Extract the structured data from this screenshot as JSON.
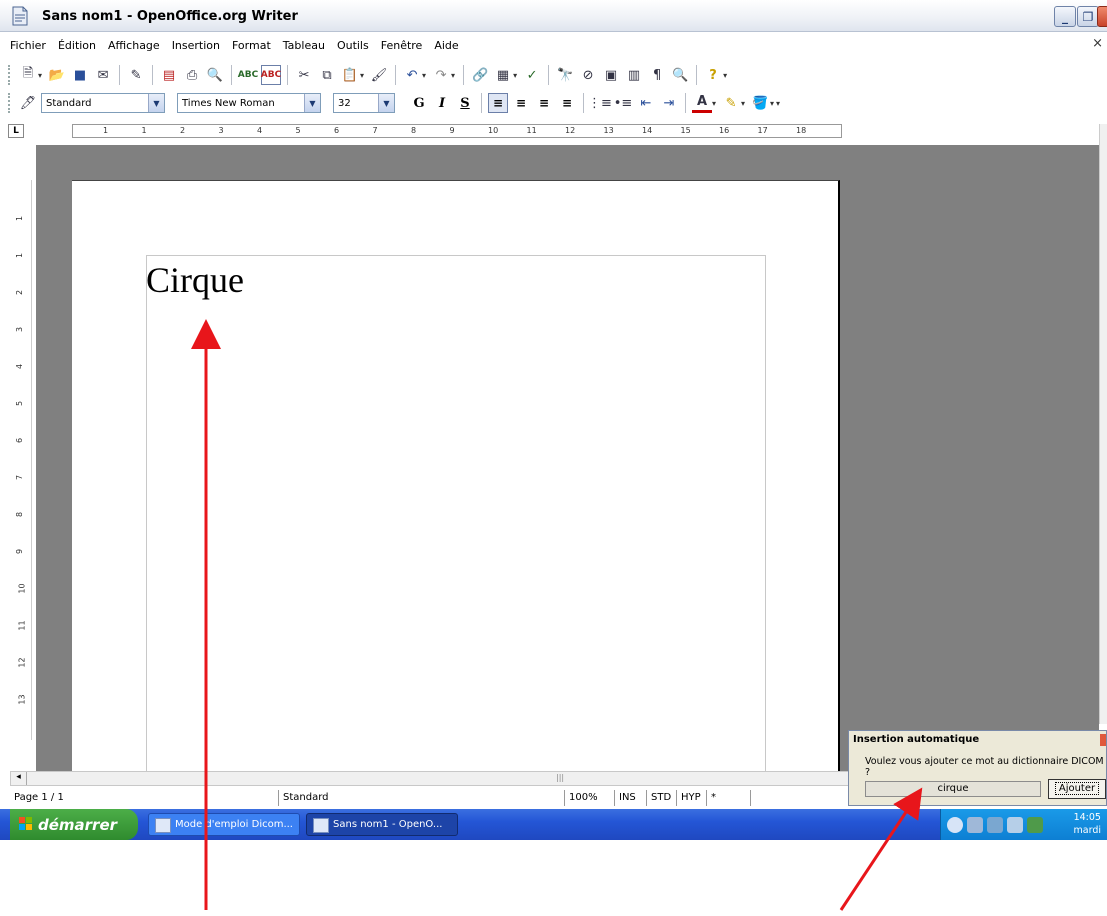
{
  "window": {
    "title": "Sans nom1 - OpenOffice.org Writer"
  },
  "menu": {
    "items": [
      "Fichier",
      "Édition",
      "Affichage",
      "Insertion",
      "Format",
      "Tableau",
      "Outils",
      "Fenêtre",
      "Aide"
    ]
  },
  "format_toolbar": {
    "style": "Standard",
    "font": "Times New Roman",
    "size": "32",
    "bold_label": "G",
    "italic_label": "I",
    "underline_label": "S"
  },
  "ruler": {
    "horizontal_marks": [
      "1",
      "1",
      "2",
      "3",
      "4",
      "5",
      "6",
      "7",
      "8",
      "9",
      "10",
      "11",
      "12",
      "13",
      "14",
      "15",
      "16",
      "17",
      "18"
    ],
    "vertical_marks": [
      "1",
      "1",
      "2",
      "3",
      "4",
      "5",
      "6",
      "7",
      "8",
      "9",
      "10",
      "11",
      "12",
      "13"
    ],
    "corner_label": "L"
  },
  "document": {
    "text": "Cirque"
  },
  "statusbar": {
    "page": "Page 1 / 1",
    "style": "Standard",
    "zoom": "100%",
    "insert_mode": "INS",
    "selection_mode": "STD",
    "hyperlink_mode": "HYP",
    "modified": "*"
  },
  "popup": {
    "title": "Insertion automatique",
    "message": "Voulez vous ajouter ce mot au dictionnaire DICOM ?",
    "word": "cirque",
    "button": "Ajouter"
  },
  "taskbar": {
    "start_label": "démarrer",
    "tasks": [
      "Mode d'emploi Dicom...",
      "Sans nom1 - OpenO..."
    ],
    "clock_time": "14:05",
    "clock_day": "mardi"
  },
  "colors": {
    "arrow": "#e8161b",
    "doc_background": "#808080",
    "taskbar": "#2456d6",
    "start_button": "#3b9a38"
  }
}
